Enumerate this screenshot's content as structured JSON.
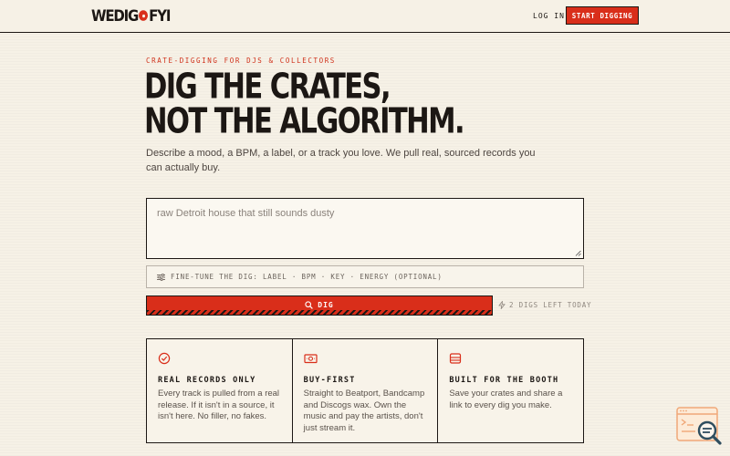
{
  "header": {
    "logo_left": "WEDIG",
    "logo_right": "FYI",
    "login_label": "LOG IN",
    "cta_label": "START DIGGING"
  },
  "hero": {
    "eyebrow": "CRATE-DIGGING FOR DJS & COLLECTORS",
    "headline_line1": "DIG THE CRATES,",
    "headline_line2": "NOT THE ALGORITHM.",
    "subtitle": "Describe a mood, a BPM, a label, or a track you love. We pull real, sourced records you can actually buy."
  },
  "search": {
    "placeholder": "raw Detroit house that still sounds dusty",
    "finetune_label": "FINE-TUNE THE DIG: LABEL · BPM · KEY · ENERGY (OPTIONAL)",
    "dig_label": "DIG",
    "digs_left": "2 DIGS LEFT TODAY"
  },
  "features": [
    {
      "icon": "check-circle-icon",
      "title": "REAL RECORDS ONLY",
      "body": "Every track is pulled from a real release. If it isn't in a source, it isn't here. No filler, no fakes."
    },
    {
      "icon": "money-icon",
      "title": "BUY-FIRST",
      "body": "Straight to Beatport, Bandcamp and Discogs wax. Own the music and pay the artists, don't just stream it."
    },
    {
      "icon": "crate-icon",
      "title": "BUILT FOR THE BOOTH",
      "body": "Save your crates and share a link to every dig you make."
    }
  ],
  "colors": {
    "accent": "#d92e1a",
    "ink": "#1c1714",
    "background": "#f6f1e6"
  }
}
